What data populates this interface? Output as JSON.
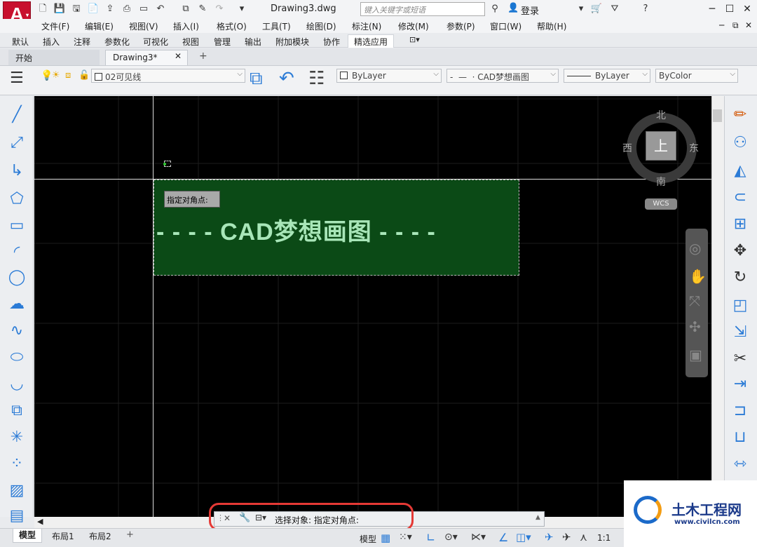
{
  "title": "Drawing3.dwg",
  "search_placeholder": "键入关键字或短语",
  "login": "登录",
  "menus": [
    "文件(F)",
    "编辑(E)",
    "视图(V)",
    "插入(I)",
    "格式(O)",
    "工具(T)",
    "绘图(D)",
    "标注(N)",
    "修改(M)",
    "参数(P)",
    "窗口(W)",
    "帮助(H)"
  ],
  "ribbon_tabs": [
    "默认",
    "插入",
    "注释",
    "参数化",
    "可视化",
    "视图",
    "管理",
    "输出",
    "附加模块",
    "协作",
    "精选应用"
  ],
  "file_tabs": {
    "start": "开始",
    "drawing": "Drawing3*",
    "new_tab": "+"
  },
  "layer": "02可见线",
  "props": {
    "color": "ByLayer",
    "linetype": "CAD梦想画图",
    "lineweight": "ByLayer",
    "plotstyle": "ByColor"
  },
  "viewcube": {
    "north": "北",
    "south": "南",
    "east": "东",
    "west": "西",
    "face": "上",
    "wcs": "WCS"
  },
  "canvas": {
    "tooltip": "指定对角点:",
    "text": "- - - - CAD梦想画图 - - - -"
  },
  "command_line": "选择对象: 指定对角点:",
  "layout_tabs": [
    "模型",
    "布局1",
    "布局2"
  ],
  "status": {
    "model": "模型",
    "scale": "1:1"
  },
  "watermark": {
    "title": "土木工程网",
    "url": "www.civilcn.com"
  },
  "colors": {
    "accent": "#c8102e",
    "selection": "#0b4a16",
    "highlight": "#e53935"
  }
}
